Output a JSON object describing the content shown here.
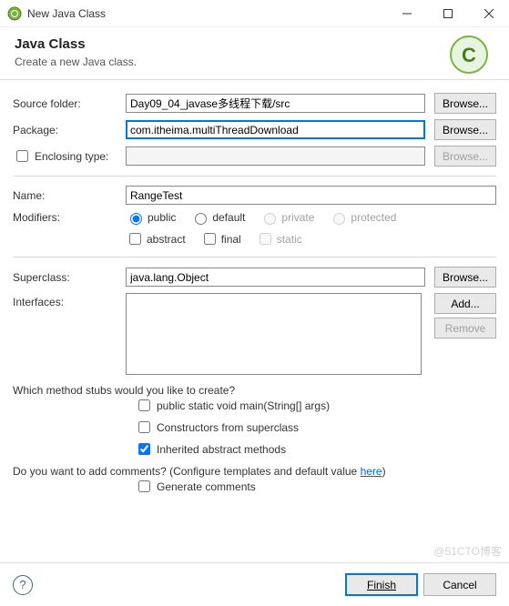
{
  "window": {
    "title": "New Java Class"
  },
  "banner": {
    "heading": "Java Class",
    "sub": "Create a new Java class."
  },
  "labels": {
    "sourceFolder": "Source folder:",
    "package": "Package:",
    "enclosing": "Enclosing type:",
    "name": "Name:",
    "modifiers": "Modifiers:",
    "superclass": "Superclass:",
    "interfaces": "Interfaces:",
    "stubsQ": "Which method stubs would you like to create?",
    "commentsQ": "Do you want to add comments? (Configure templates and default value ",
    "hereLink": "here",
    "commentsQEnd": ")"
  },
  "buttons": {
    "browse": "Browse...",
    "add": "Add...",
    "remove": "Remove",
    "finish": "Finish",
    "cancel": "Cancel"
  },
  "fields": {
    "sourceFolder": "Day09_04_javase多线程下载/src",
    "package": "com.itheima.multiThreadDownload",
    "enclosing": "",
    "name": "RangeTest",
    "superclass": "java.lang.Object"
  },
  "modifiers": {
    "public": "public",
    "default": "default",
    "private": "private",
    "protected": "protected",
    "abstract": "abstract",
    "final": "final",
    "static": "static"
  },
  "stubs": {
    "main": "public static void main(String[] args)",
    "constructors": "Constructors from superclass",
    "inherited": "Inherited abstract methods"
  },
  "comments": {
    "generate": "Generate comments"
  },
  "watermark": "@51CTO博客"
}
